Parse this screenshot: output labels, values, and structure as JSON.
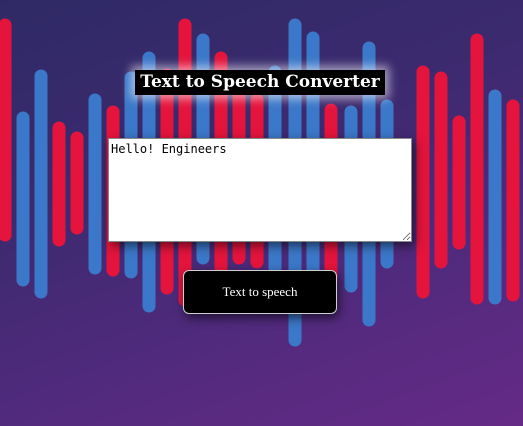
{
  "page": {
    "title": "Text to Speech Converter"
  },
  "textarea": {
    "value": "Hello! Engineers"
  },
  "button": {
    "label": "Text to speech"
  },
  "colors": {
    "red_bar": "#e4143c",
    "blue_bar": "#3b78c9",
    "background_start": "#2f2a66",
    "background_end": "#652a86"
  },
  "icons": [
    "resize-grip-icon"
  ]
}
